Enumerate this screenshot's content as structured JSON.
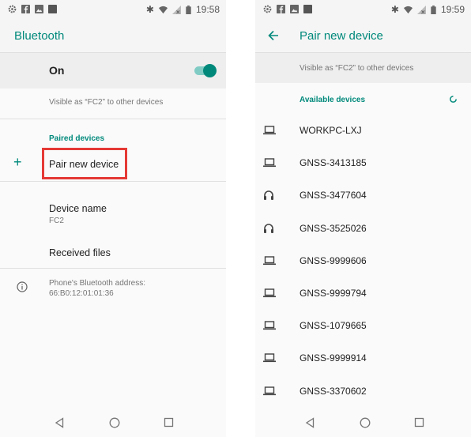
{
  "left": {
    "status": {
      "time": "19:58"
    },
    "title": "Bluetooth",
    "toggle_label": "On",
    "visible_text": "Visible as “FC2” to other devices",
    "paired_header": "Paired devices",
    "pair_new_label": "Pair new device",
    "device_name_label": "Device name",
    "device_name_value": "FC2",
    "received_files_label": "Received files",
    "address_label": "Phone's Bluetooth address:",
    "address_value": "66:B0:12:01:01:36"
  },
  "right": {
    "status": {
      "time": "19:59"
    },
    "title": "Pair new device",
    "visible_text": "Visible as “FC2” to other devices",
    "available_header": "Available devices",
    "devices": [
      {
        "name": "WORKPC-LXJ",
        "icon": "laptop-icon"
      },
      {
        "name": "GNSS-3413185",
        "icon": "laptop-icon"
      },
      {
        "name": "GNSS-3477604",
        "icon": "headset-icon"
      },
      {
        "name": "GNSS-3525026",
        "icon": "headset-icon"
      },
      {
        "name": "GNSS-9999606",
        "icon": "laptop-icon"
      },
      {
        "name": "GNSS-9999794",
        "icon": "laptop-icon"
      },
      {
        "name": "GNSS-1079665",
        "icon": "laptop-icon"
      },
      {
        "name": "GNSS-9999914",
        "icon": "laptop-icon"
      },
      {
        "name": "GNSS-3370602",
        "icon": "laptop-icon"
      }
    ]
  },
  "colors": {
    "accent": "#00897b",
    "highlight": "#e53935"
  }
}
